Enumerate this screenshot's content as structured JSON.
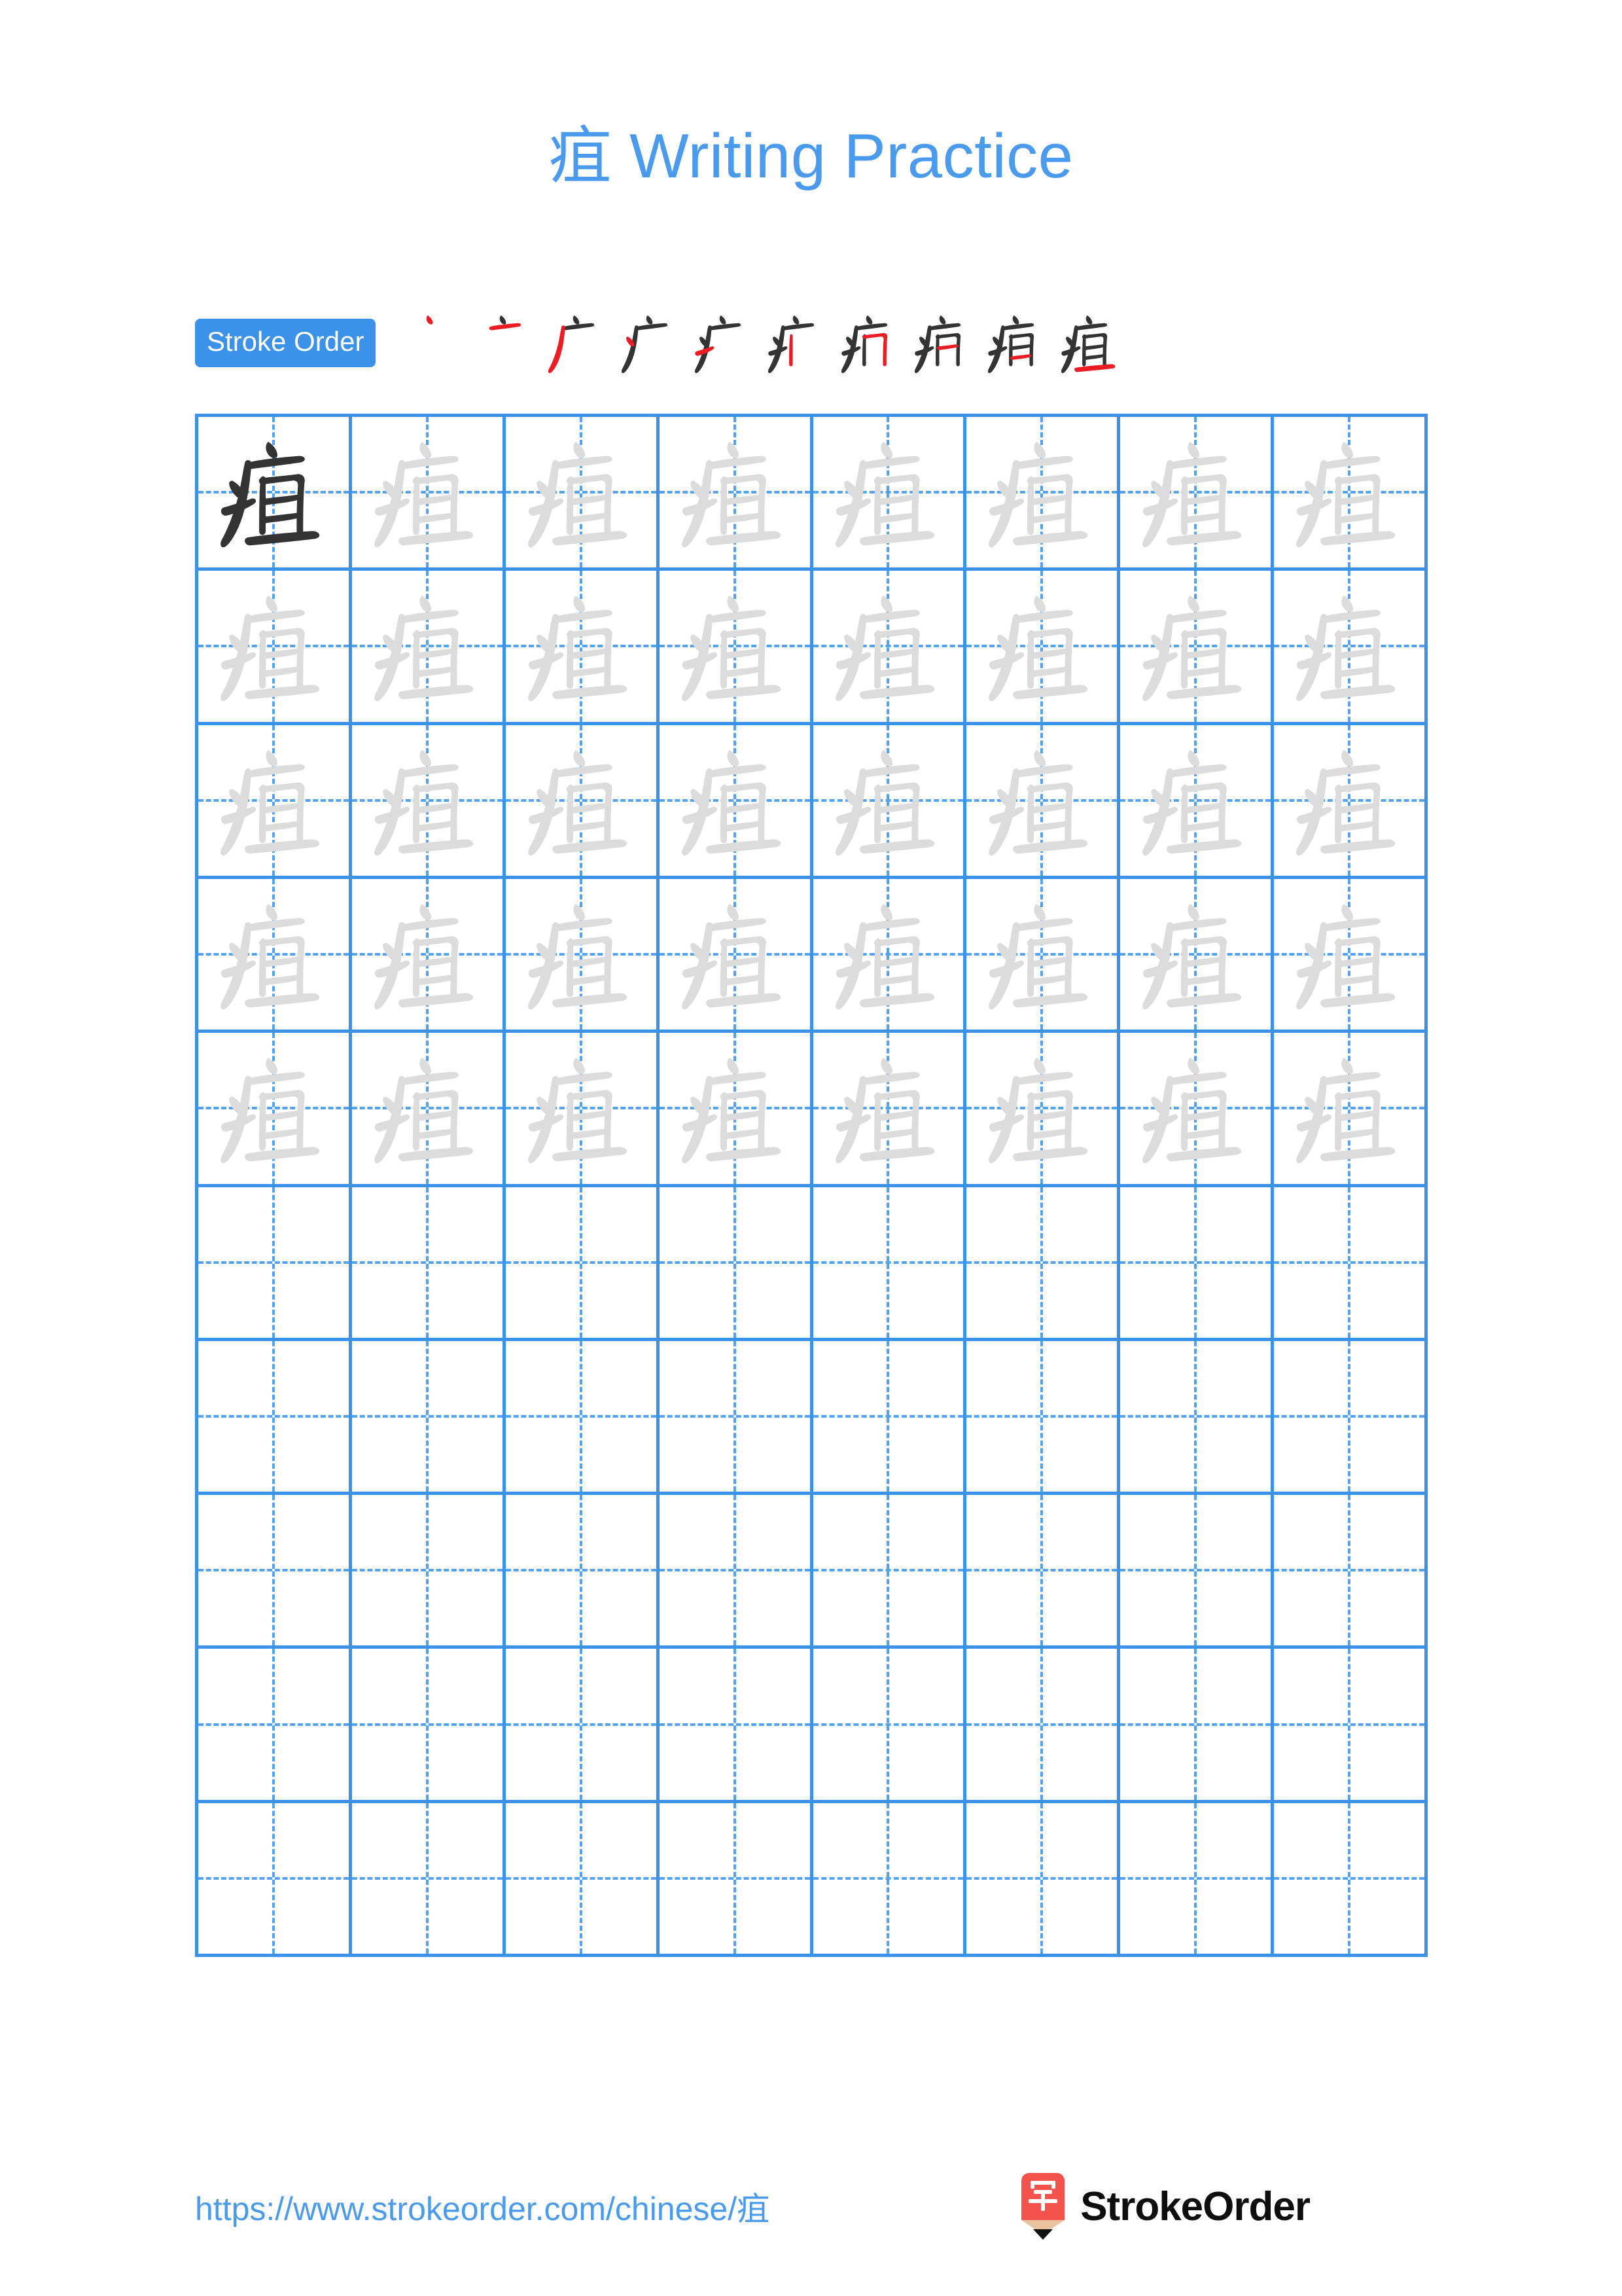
{
  "character": "疽",
  "title": {
    "character": "疽",
    "suffix": " Writing Practice",
    "full": "疽 Writing Practice",
    "color": "#4a9aed"
  },
  "stroke_order": {
    "badge_label": "Stroke Order",
    "badge_bg": "#3b92e8",
    "badge_text_color": "#ffffff",
    "total_strokes": 10,
    "new_stroke_color": "#ec1c24",
    "prior_stroke_color": "#333333",
    "steps": [
      {
        "index": 1,
        "strokes_shown": 1,
        "new_stroke": 1,
        "name": "dian-dot"
      },
      {
        "index": 2,
        "strokes_shown": 2,
        "new_stroke": 2,
        "name": "heng-horizontal"
      },
      {
        "index": 3,
        "strokes_shown": 3,
        "new_stroke": 3,
        "name": "pie-left-falling"
      },
      {
        "index": 4,
        "strokes_shown": 4,
        "new_stroke": 4,
        "name": "dian-left-dot"
      },
      {
        "index": 5,
        "strokes_shown": 5,
        "new_stroke": 5,
        "name": "ti-rising"
      },
      {
        "index": 6,
        "strokes_shown": 6,
        "new_stroke": 6,
        "name": "shu-vertical"
      },
      {
        "index": 7,
        "strokes_shown": 7,
        "new_stroke": 7,
        "name": "hengzhe-turn"
      },
      {
        "index": 8,
        "strokes_shown": 8,
        "new_stroke": 8,
        "name": "heng-inner-upper"
      },
      {
        "index": 9,
        "strokes_shown": 9,
        "new_stroke": 9,
        "name": "heng-inner-lower"
      },
      {
        "index": 10,
        "strokes_shown": 10,
        "new_stroke": 10,
        "name": "heng-base"
      }
    ]
  },
  "grid": {
    "columns": 8,
    "rows": 10,
    "line_color": "#3b92e8",
    "guide_color": "#54a3f0",
    "model_glyph_color": "#333333",
    "trace_glyph_color": "#dcdcdc",
    "filled_rows": 5,
    "cells": [
      [
        "model",
        "trace",
        "trace",
        "trace",
        "trace",
        "trace",
        "trace",
        "trace"
      ],
      [
        "trace",
        "trace",
        "trace",
        "trace",
        "trace",
        "trace",
        "trace",
        "trace"
      ],
      [
        "trace",
        "trace",
        "trace",
        "trace",
        "trace",
        "trace",
        "trace",
        "trace"
      ],
      [
        "trace",
        "trace",
        "trace",
        "trace",
        "trace",
        "trace",
        "trace",
        "trace"
      ],
      [
        "trace",
        "trace",
        "trace",
        "trace",
        "trace",
        "trace",
        "trace",
        "trace"
      ],
      [
        "empty",
        "empty",
        "empty",
        "empty",
        "empty",
        "empty",
        "empty",
        "empty"
      ],
      [
        "empty",
        "empty",
        "empty",
        "empty",
        "empty",
        "empty",
        "empty",
        "empty"
      ],
      [
        "empty",
        "empty",
        "empty",
        "empty",
        "empty",
        "empty",
        "empty",
        "empty"
      ],
      [
        "empty",
        "empty",
        "empty",
        "empty",
        "empty",
        "empty",
        "empty",
        "empty"
      ],
      [
        "empty",
        "empty",
        "empty",
        "empty",
        "empty",
        "empty",
        "empty",
        "empty"
      ]
    ]
  },
  "footer": {
    "url": "https://www.strokeorder.com/chinese/疽",
    "url_color": "#4a9aed",
    "logo": {
      "mark_character": "字",
      "mark_body_color": "#f4534d",
      "mark_wood_color": "#e8c39e",
      "mark_tip_color": "#111111",
      "wordmark": "StrokeOrder",
      "wordmark_color": "#0d0d0d"
    }
  }
}
